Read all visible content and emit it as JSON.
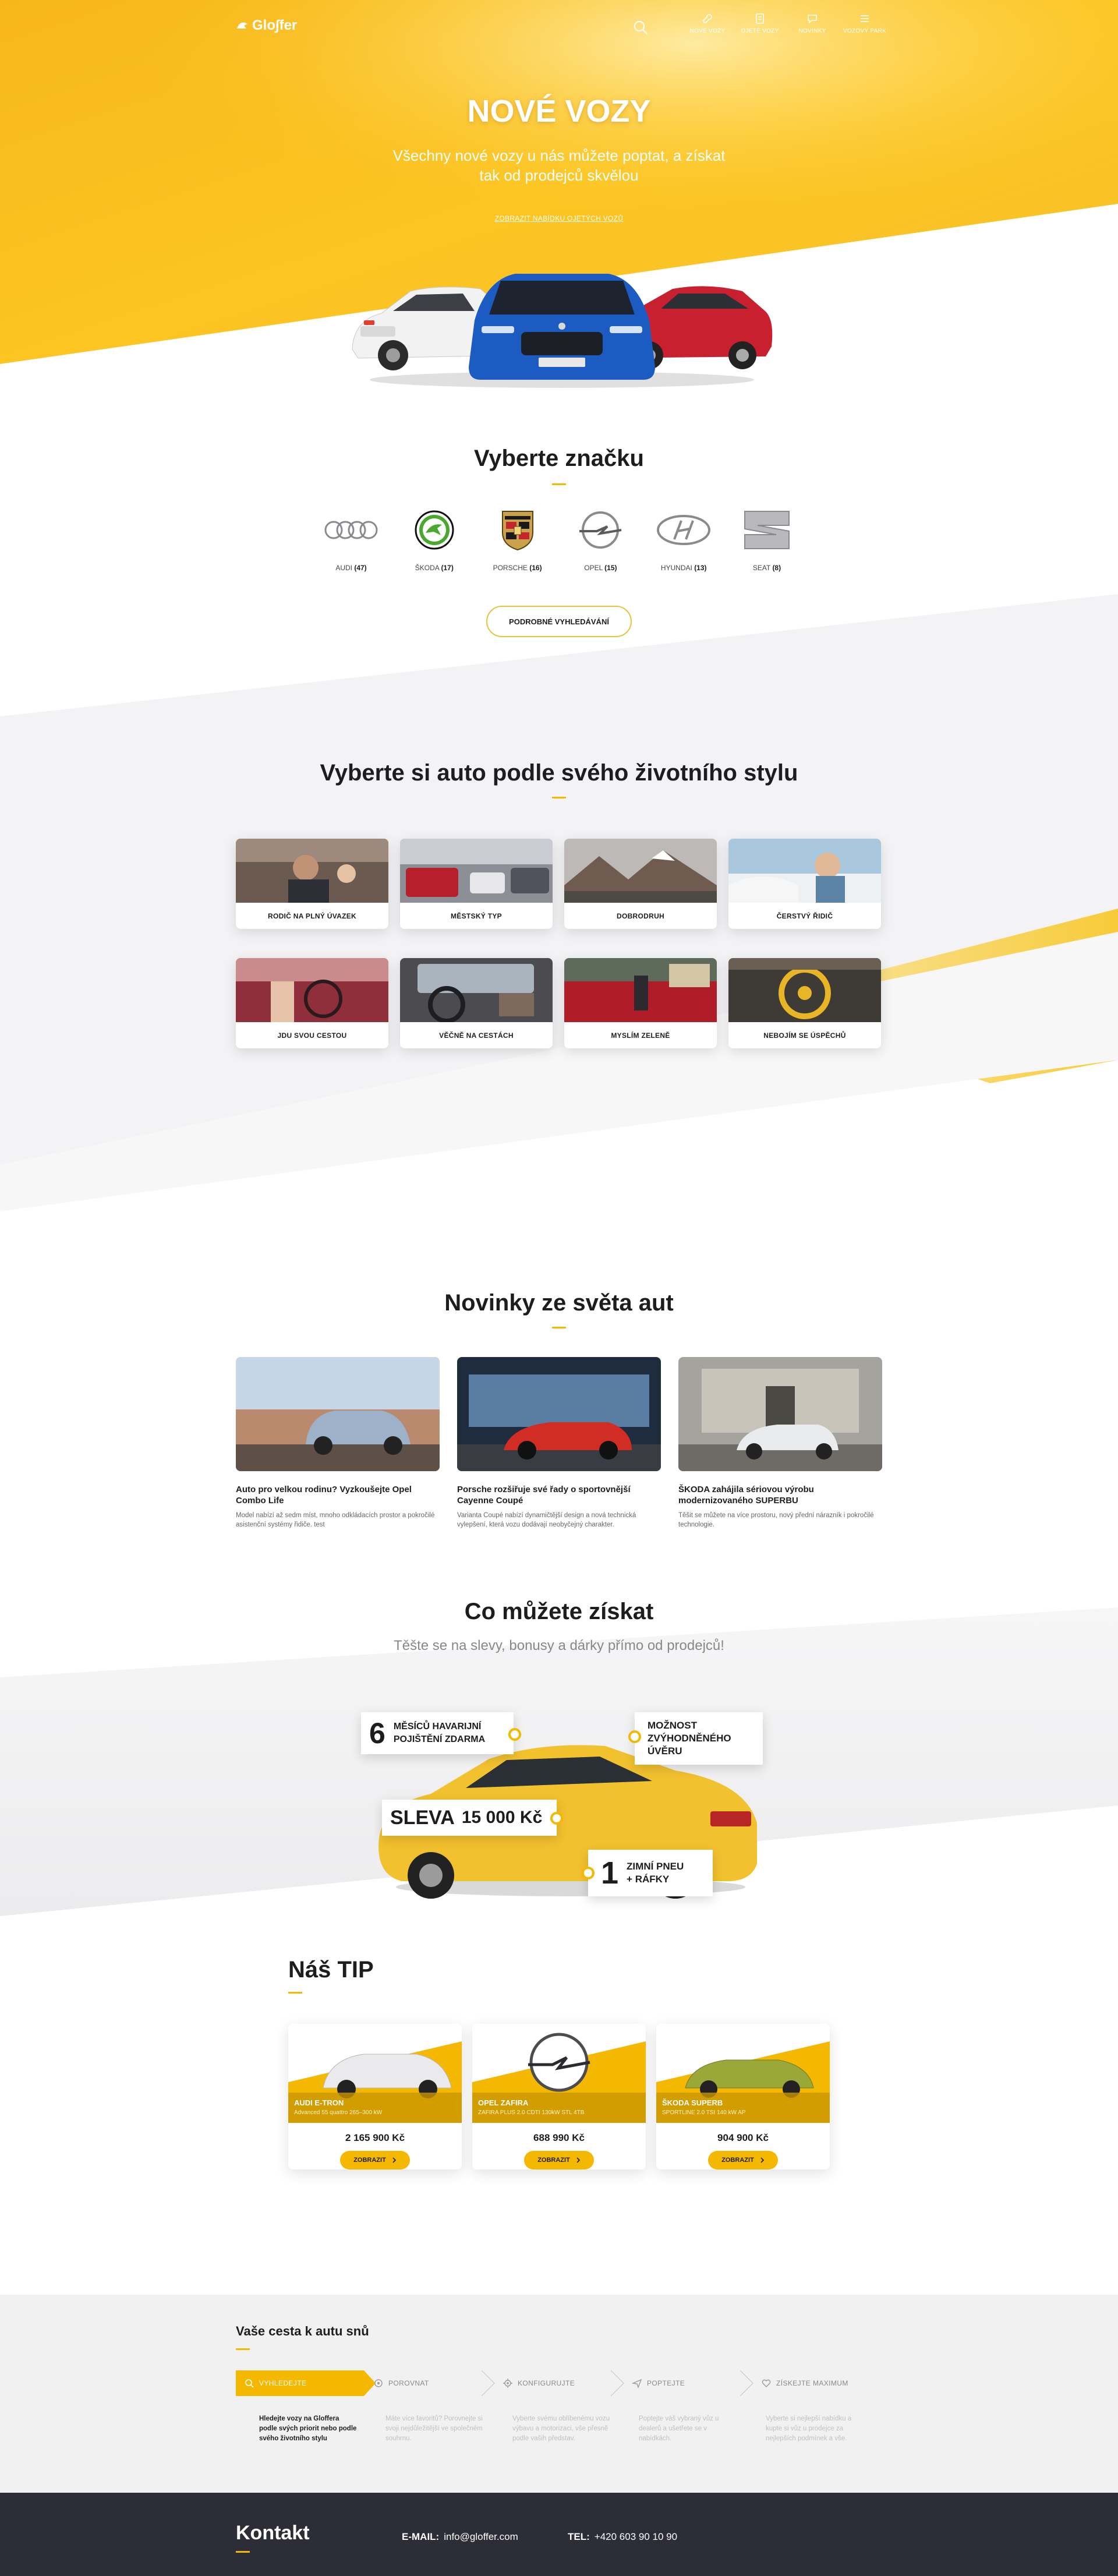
{
  "colors": {
    "accent": "#f5b800",
    "dark": "#2d2d38",
    "text": "#1d1d1f"
  },
  "header": {
    "logo": "Glo∫fer",
    "search_icon": "search-icon",
    "nav": [
      {
        "label": "NOVÉ VOZY",
        "icon": "car-key-icon"
      },
      {
        "label": "OJETÉ VOZY",
        "icon": "document-icon"
      },
      {
        "label": "NOVINKY",
        "icon": "chat-icon"
      },
      {
        "label": "VOZOVÝ PARK",
        "icon": "menu-icon"
      }
    ]
  },
  "hero": {
    "title": "NOVÉ VOZY",
    "subtitle": "Všechny nové vozy u nás můžete poptat, a získat tak od prodejců skvělou",
    "link": "ZOBRAZIT NABÍDKU OJETÝCH VOZŮ"
  },
  "brands": {
    "title": "Vyberte značku",
    "items": [
      {
        "name": "AUDI",
        "count": "(47)"
      },
      {
        "name": "ŠKODA",
        "count": "(17)"
      },
      {
        "name": "PORSCHE",
        "count": "(16)"
      },
      {
        "name": "OPEL",
        "count": "(15)"
      },
      {
        "name": "HYUNDAI",
        "count": "(13)"
      },
      {
        "name": "SEAT",
        "count": "(8)"
      }
    ],
    "button": "PODROBNÉ VYHLEDÁVÁNÍ"
  },
  "lifestyle": {
    "title": "Vyberte si auto podle svého životního stylu",
    "items": [
      "RODIČ NA PLNÝ ÚVAZEK",
      "MĚSTSKÝ TYP",
      "DOBRODRUH",
      "ČERSTVÝ ŘIDIČ",
      "JDU SVOU CESTOU",
      "VĚČNĚ NA CESTÁCH",
      "MYSLÍM ZELENĚ",
      "NEBOJÍM SE ÚSPĚCHŮ"
    ]
  },
  "news": {
    "title": "Novinky ze světa aut",
    "items": [
      {
        "title": "Auto pro velkou rodinu? Vyzkoušejte Opel Combo Life",
        "text": "Model nabízí až sedm míst, mnoho odkládacích prostor a pokročilé asistenční systémy řidiče. test"
      },
      {
        "title": "Porsche rozšiřuje své řady o sportovnější Cayenne Coupé",
        "text": "Varianta Coupé nabízí dynamičtější design a nová technická vylepšení, která vozu dodávají neobyčejný charakter."
      },
      {
        "title": "ŠKODA zahájila sériovou výrobu modernizovaného SUPERBU",
        "text": "Těšit se můžete na více prostoru, nový přední nárazník i pokročilé technologie."
      }
    ]
  },
  "gain": {
    "title": "Co můžete získat",
    "subtitle": "Těšte se na slevy, bonusy a dárky přímo od prodejců!",
    "badges": {
      "insurance_num": "6",
      "insurance_text_1": "MĚSÍCŮ HAVARIJNÍ",
      "insurance_text_2": "POJIŠTĚNÍ ZDARMA",
      "loan_1": "MOŽNOST",
      "loan_2": "ZVÝHODNĚNÉHO",
      "loan_3": "ÚVĚRU",
      "discount_label": "SLEVA",
      "discount_value": "15 000 Kč",
      "tires_num": "1",
      "tires_text_1": "ZIMNÍ PNEU",
      "tires_text_2": "+ RÁFKY"
    }
  },
  "tip": {
    "title": "Náš TIP",
    "items": [
      {
        "name": "AUDI E-TRON",
        "spec": "Advanced 55 quattro 265–300 kW",
        "price": "2 165 900 Kč",
        "button": "ZOBRAZIT"
      },
      {
        "name": "OPEL ZAFIRA",
        "spec": "ZAFIRA PLUS 2.0 CDTI 130kW STL 4TB",
        "price": "688 990 Kč",
        "button": "ZOBRAZIT"
      },
      {
        "name": "ŠKODA SUPERB",
        "spec": "SPORTLINE 2.0 TSI 140 kW AP",
        "price": "904 900 Kč",
        "button": "ZOBRAZIT"
      }
    ]
  },
  "journey": {
    "title": "Vaše cesta k autu snů",
    "steps": [
      {
        "label": "VYHLEDEJTE",
        "icon": "search-icon",
        "text": "Hledejte vozy na Gloffera podle svých priorit nebo podle svého životního stylu"
      },
      {
        "label": "POROVNAT",
        "icon": "compare-icon",
        "text": "Máte více favoritů? Porovnejte si svoji nejdůležitější ve společném souhrnu."
      },
      {
        "label": "KONFIGURUJTE",
        "icon": "gear-icon",
        "text": "Vyberte svému oblíbenému vozu výbavu a motorizaci, vše přesně podle vaših představ."
      },
      {
        "label": "POPTEJTE",
        "icon": "send-icon",
        "text": "Poptejte váš vybraný vůz u dealerů a ušetřete se v nabídkách."
      },
      {
        "label": "ZÍSKEJTE MAXIMUM",
        "icon": "heart-icon",
        "text": "Vyberte si nejlepší nabídku a kupte si vůz u prodejce za nejlepších podmínek a vše."
      }
    ]
  },
  "footer": {
    "title": "Kontakt",
    "email_label": "E-MAIL:",
    "email": "info@gloffer.com",
    "phone_label": "TEL:",
    "phone": "+420 603 90 10 90"
  }
}
